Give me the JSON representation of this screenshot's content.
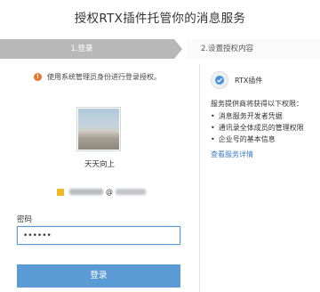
{
  "page": {
    "title": "授权RTX插件托管你的消息服务"
  },
  "steps": [
    {
      "label": "1.登录"
    },
    {
      "label": "2.设置授权内容"
    }
  ],
  "notice": {
    "text": "使用系统管理员身份进行登录授权。"
  },
  "user": {
    "name": "天天向上",
    "account_separator": "@"
  },
  "password": {
    "label": "密码",
    "value": "••••••"
  },
  "login": {
    "button_label": "登录"
  },
  "plugin": {
    "name": "RTX插件"
  },
  "services": {
    "title": "服务提供商将获得以下权限：",
    "items": [
      "消息服务开发者凭据",
      "通讯录全体成员的管理权限",
      "企业号的基本信息"
    ],
    "details_link": "查看服务详情"
  }
}
